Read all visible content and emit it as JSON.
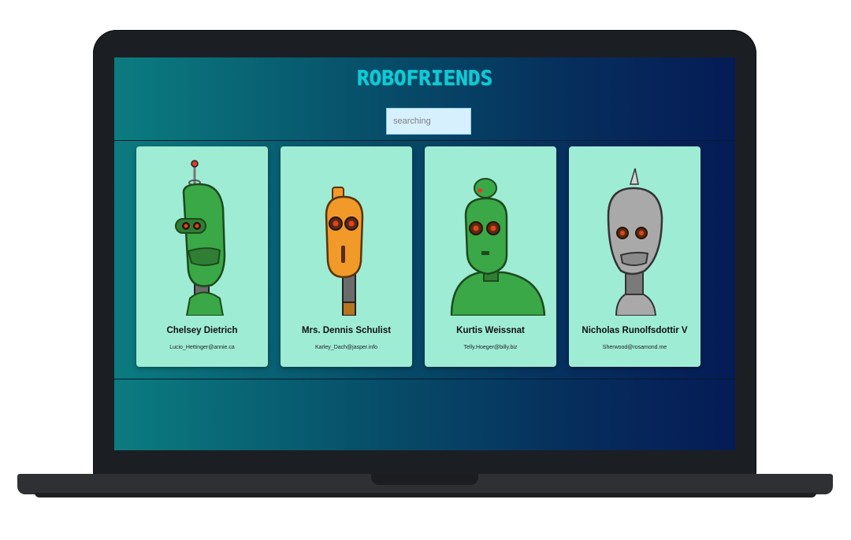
{
  "app": {
    "title": "ROBOFRIENDS"
  },
  "search": {
    "placeholder": "searching",
    "value": ""
  },
  "robots": [
    {
      "name": "Chelsey Dietrich",
      "email": "Lucio_Hettinger@annie.ca",
      "color": "#3aa846",
      "icon": "green-antenna-robot-icon"
    },
    {
      "name": "Mrs. Dennis Schulist",
      "email": "Karley_Dach@jasper.info",
      "color": "#f19a2a",
      "icon": "orange-robot-icon"
    },
    {
      "name": "Kurtis Weissnat",
      "email": "Telly.Hoeger@billy.biz",
      "color": "#3aa846",
      "icon": "green-broad-robot-icon"
    },
    {
      "name": "Nicholas Runolfsdottir V",
      "email": "Sherwood@rosamond.me",
      "color": "#a9a9a9",
      "icon": "silver-spike-robot-icon"
    }
  ],
  "colors": {
    "card_background": "#9fecd5",
    "title_color": "#12c8d6",
    "search_background": "#d7f0fd"
  }
}
